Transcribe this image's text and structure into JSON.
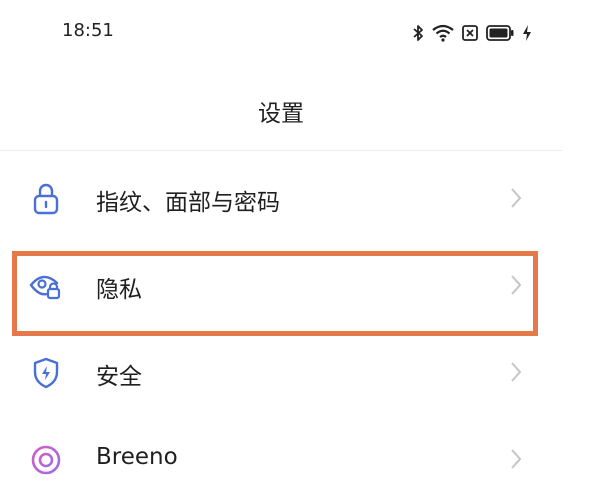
{
  "status_bar": {
    "time": "18:51",
    "icons": [
      "bluetooth-icon",
      "wifi-icon",
      "no-sim-icon",
      "battery-icon",
      "charging-icon"
    ]
  },
  "header": {
    "title": "设置"
  },
  "settings": {
    "items": [
      {
        "label": "指纹、面部与密码",
        "icon": "lock-icon",
        "icon_color": "#4a6fd6"
      },
      {
        "label": "隐私",
        "icon": "privacy-eye-lock-icon",
        "icon_color": "#4a6fd6"
      },
      {
        "label": "安全",
        "icon": "shield-bolt-icon",
        "icon_color": "#4a6fd6"
      },
      {
        "label": "Breeno",
        "icon": "breeno-icon",
        "icon_color": "#c266c9"
      }
    ]
  },
  "highlight": {
    "target": "隐私",
    "color": "#e5794a"
  }
}
